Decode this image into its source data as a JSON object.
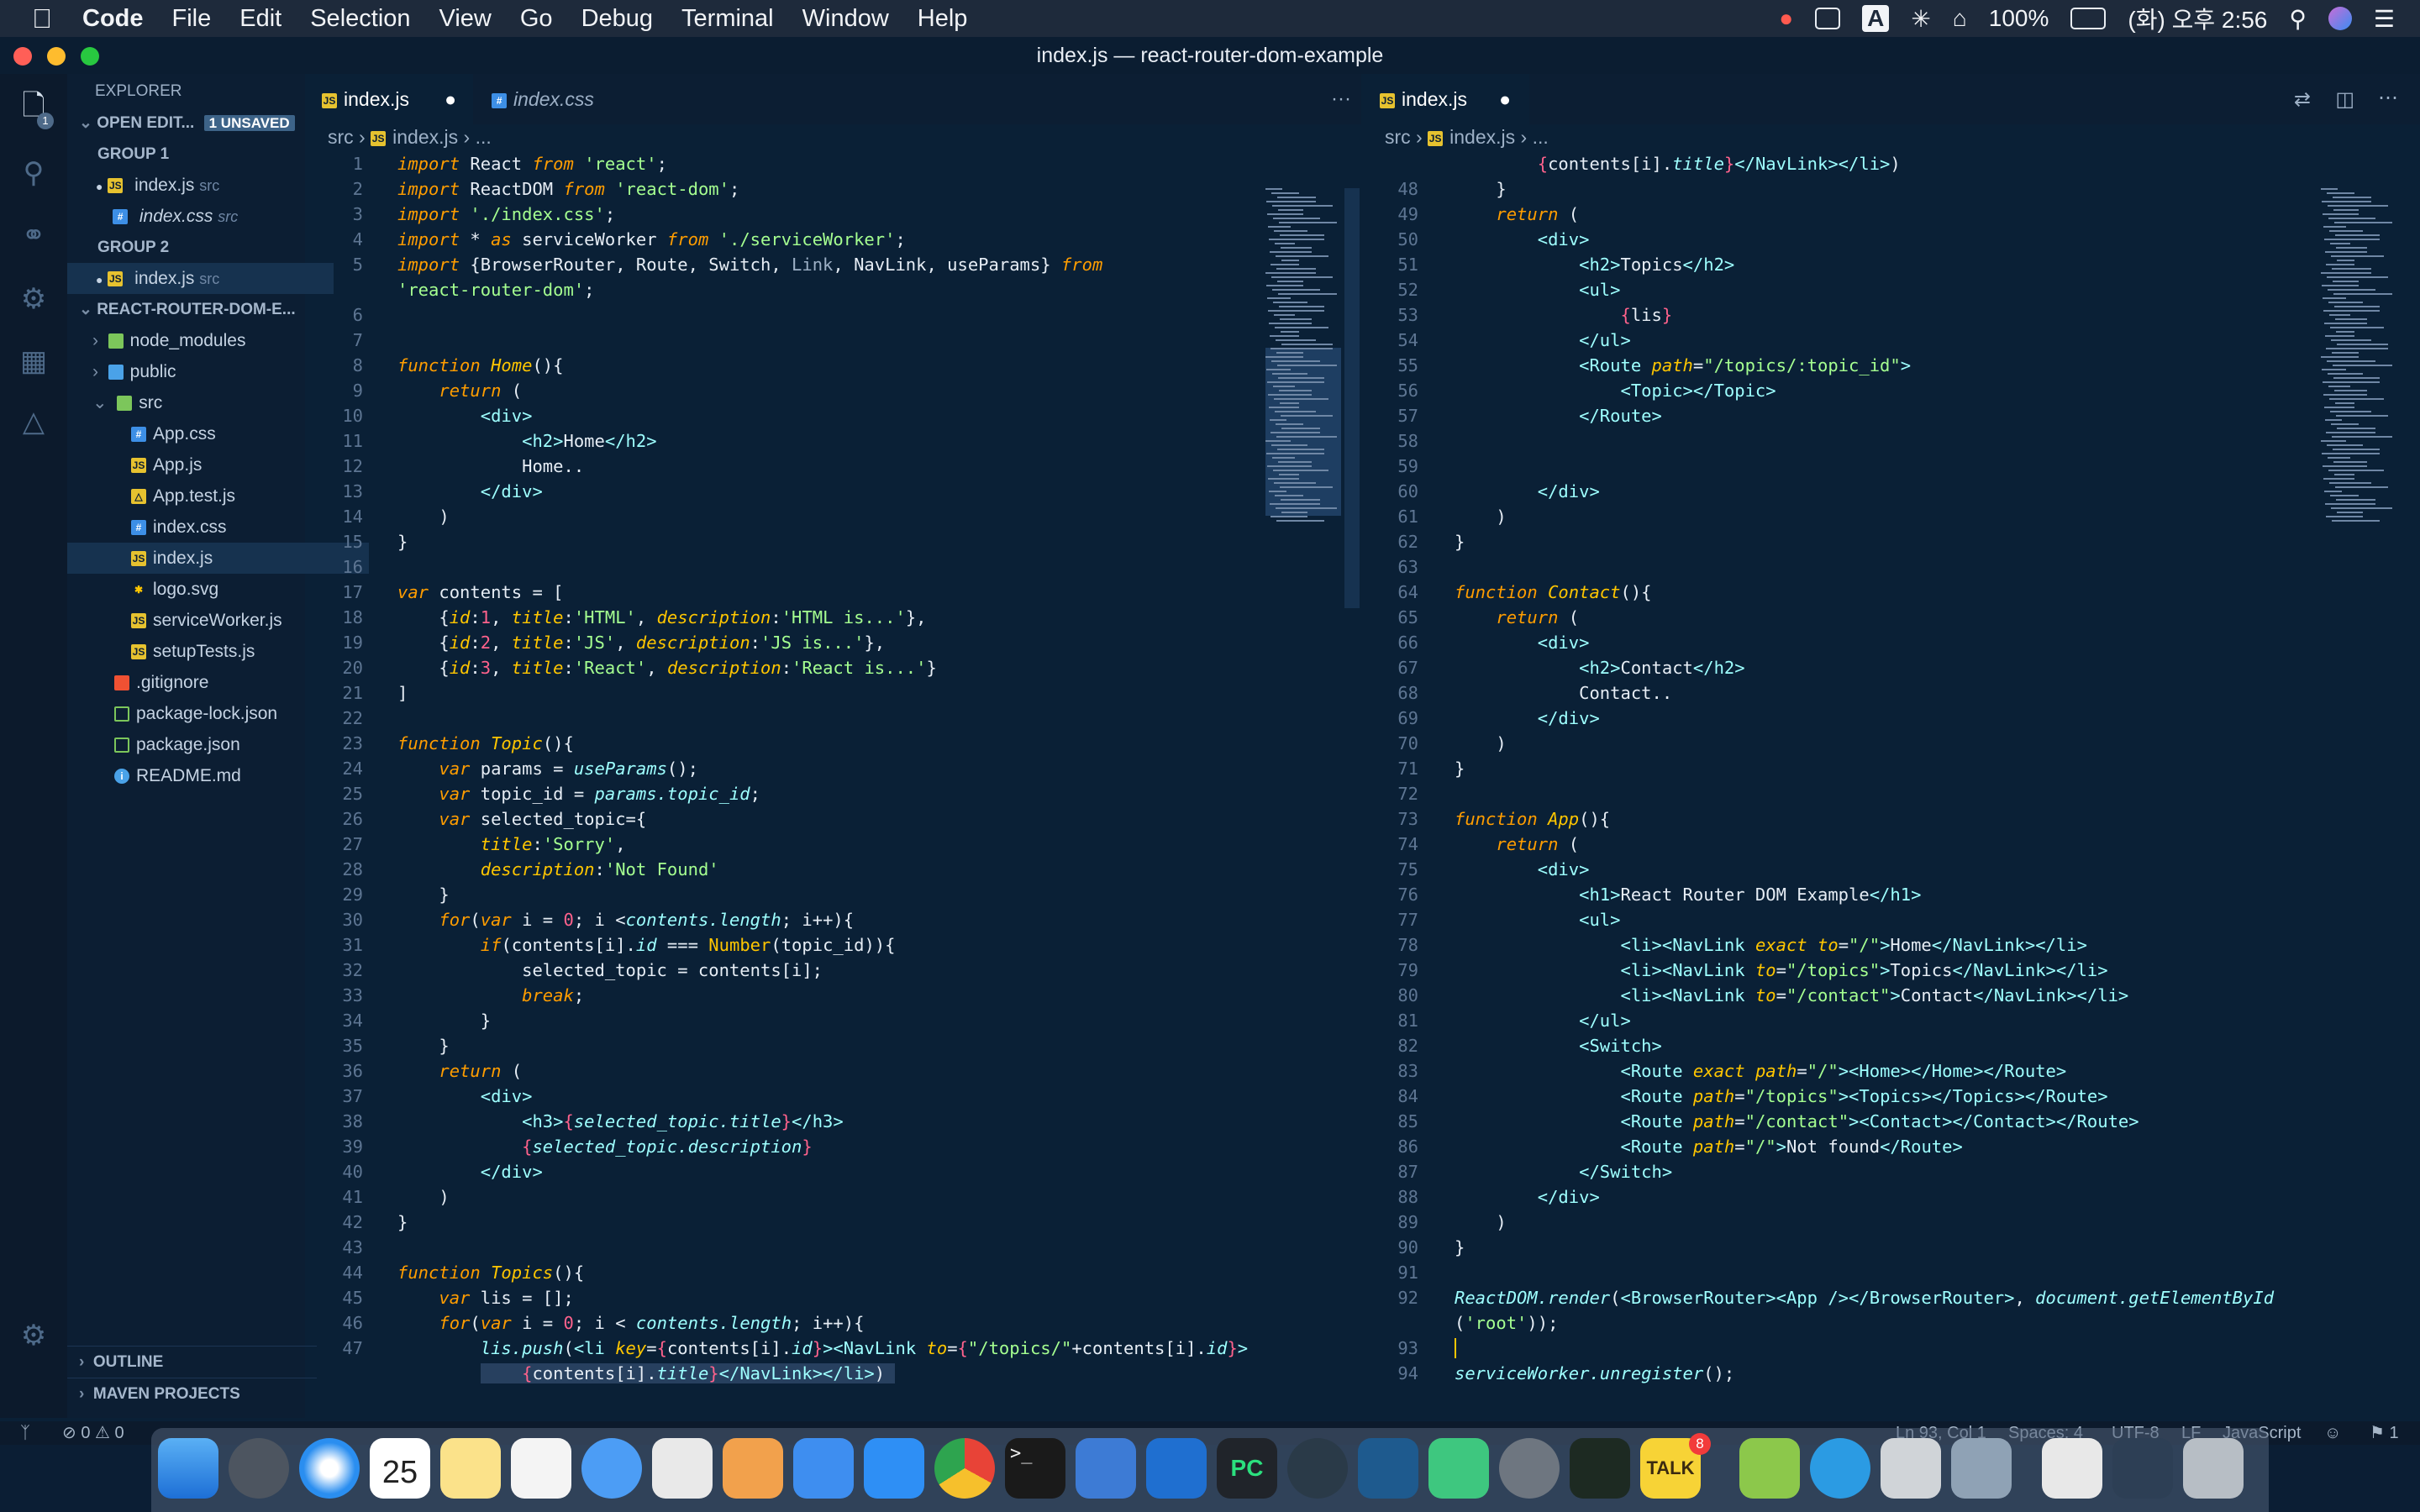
{
  "menubar": {
    "apple": "",
    "app": "Code",
    "items": [
      "File",
      "Edit",
      "Selection",
      "View",
      "Go",
      "Debug",
      "Terminal",
      "Window",
      "Help"
    ],
    "right": {
      "input": "A",
      "battery": "100%",
      "clock": "(화) 오후 2:56"
    }
  },
  "window": {
    "title": "index.js — react-router-dom-example"
  },
  "sidebar": {
    "header": "EXPLORER",
    "open_editors": "OPEN EDIT...",
    "unsaved": "1 UNSAVED",
    "group1": "GROUP 1",
    "group2": "GROUP 2",
    "g1_files": [
      {
        "name": "index.js",
        "dir": "src"
      },
      {
        "name": "index.css",
        "dir": "src"
      }
    ],
    "g2_files": [
      {
        "name": "index.js",
        "dir": "src"
      }
    ],
    "project": "REACT-ROUTER-DOM-E...",
    "tree": [
      "node_modules",
      "public",
      "src",
      "App.css",
      "App.js",
      "App.test.js",
      "index.css",
      "index.js",
      "logo.svg",
      "serviceWorker.js",
      "setupTests.js",
      ".gitignore",
      "package-lock.json",
      "package.json",
      "README.md"
    ],
    "outline": "OUTLINE",
    "maven": "MAVEN PROJECTS"
  },
  "left_editor": {
    "tabs": [
      {
        "label": "index.js"
      },
      {
        "label": "index.css"
      }
    ],
    "more": "···",
    "breadcrumb": [
      "src",
      "index.js",
      "..."
    ]
  },
  "right_editor": {
    "tabs": [
      {
        "label": "index.js"
      }
    ],
    "breadcrumb": [
      "src",
      "index.js",
      "..."
    ]
  },
  "status": {
    "errors": "0",
    "warnings": "0",
    "position": "Ln 93, Col 1",
    "spaces": "Spaces: 4",
    "encoding": "UTF-8",
    "eol": "LF",
    "language": "JavaScript",
    "notifications": "1"
  },
  "dock": {
    "calendar_day": "25",
    "talk_badge": "8"
  },
  "colors": {
    "keyword": "#ff9d00",
    "string": "#a5ff90",
    "function": "#ffc600",
    "background": "#0a2036"
  }
}
